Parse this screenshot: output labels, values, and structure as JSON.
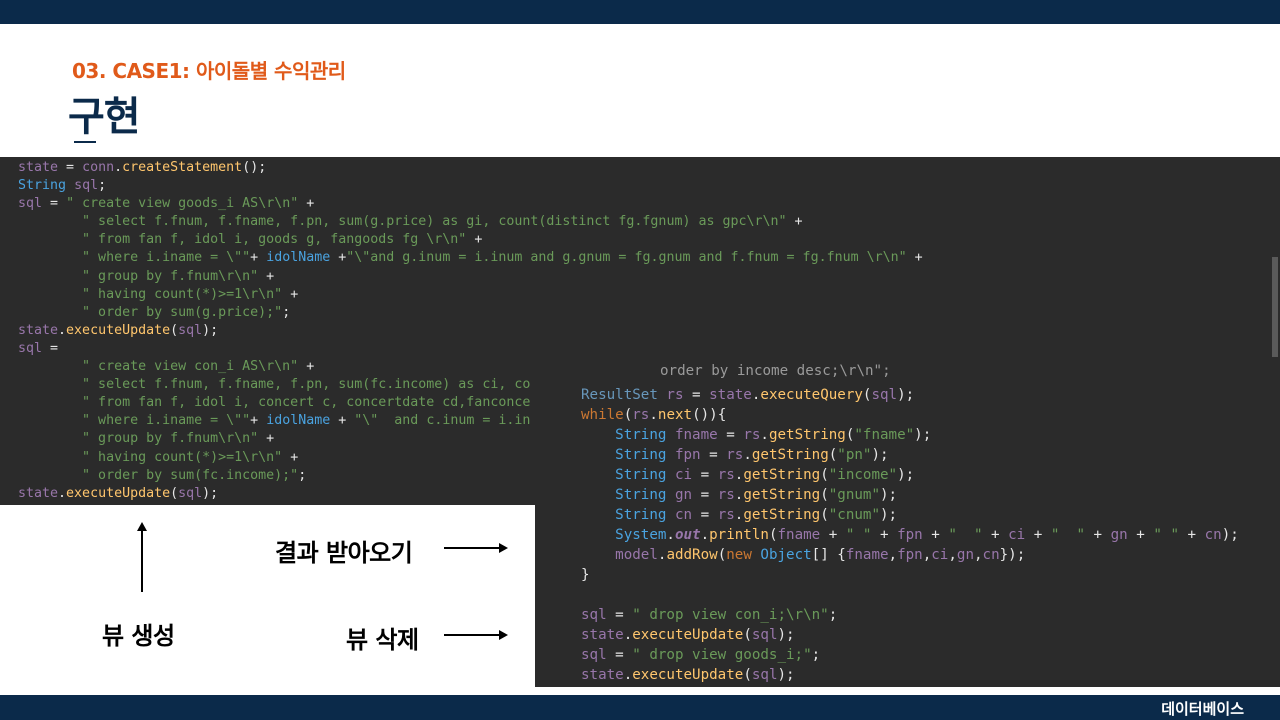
{
  "header": {
    "subtitle": "03. CASE1: 아이돌별 수익관리",
    "title": "구현"
  },
  "footer": {
    "label": "데이터베이스"
  },
  "annotations": {
    "create_view": "뷰 생성",
    "receive_result": "결과 받아오기",
    "drop_view": "뷰 삭제"
  },
  "code_left": {
    "lines": [
      "state = conn.createStatement();",
      "String sql;",
      "sql = \" create view goods_i AS\\r\\n\" +",
      "        \" select f.fnum, f.fname, f.pn, sum(g.price) as gi, count(distinct fg.fgnum) as gpc\\r\\n\" +",
      "        \" from fan f, idol i, goods g, fangoods fg \\r\\n\" +",
      "        \" where i.iname = \\\"\"+ idolName +\"\\\"and g.inum = i.inum and g.gnum = fg.gnum and f.fnum = fg.fnum \\r\\n\" +",
      "        \" group by f.fnum\\r\\n\" +",
      "        \" having count(*)>=1\\r\\n\" +",
      "        \" order by sum(g.price);\";",
      "state.executeUpdate(sql);",
      "sql =",
      "        \" create view con_i AS\\r\\n\" +",
      "        \" select f.fnum, f.fname, f.pn, sum(fc.income) as ci, co",
      "        \" from fan f, idol i, concert c, concertdate cd,fanconce",
      "        \" where i.iname = \\\"\"+ idolName + \"\\\"  and c.inum = i.in",
      "        \" group by f.fnum\\r\\n\" +",
      "        \" having count(*)>=1\\r\\n\" +",
      "        \" order by sum(fc.income);\";",
      "state.executeUpdate(sql);"
    ]
  },
  "code_right": {
    "clipped_line": "order by income desc;\\r\\n\";",
    "lines": [
      "ResultSet rs = state.executeQuery(sql);",
      "while(rs.next()){",
      "    String fname = rs.getString(\"fname\");",
      "    String fpn = rs.getString(\"pn\");",
      "    String ci = rs.getString(\"income\");",
      "    String gn = rs.getString(\"gnum\");",
      "    String cn = rs.getString(\"cnum\");",
      "    System.out.println(fname + \" \" + fpn + \"  \" + ci + \"  \" + gn + \" \" + cn);",
      "    model.addRow(new Object[] {fname,fpn,ci,gn,cn});",
      "}",
      "",
      "sql = \" drop view con_i;\\r\\n\";",
      "state.executeUpdate(sql);",
      "sql = \" drop view goods_i;\";",
      "state.executeUpdate(sql);"
    ]
  },
  "colors": {
    "navy": "#0b2a4a",
    "orange": "#e05a1a",
    "editor_bg": "#2b2b2b"
  }
}
